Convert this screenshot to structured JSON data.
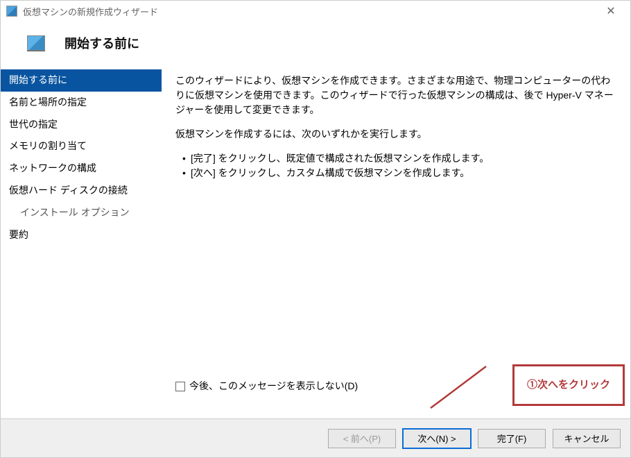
{
  "titlebar": {
    "title": "仮想マシンの新規作成ウィザード"
  },
  "header": {
    "title": "開始する前に"
  },
  "sidebar": {
    "items": [
      {
        "label": "開始する前に",
        "selected": true
      },
      {
        "label": "名前と場所の指定"
      },
      {
        "label": "世代の指定"
      },
      {
        "label": "メモリの割り当て"
      },
      {
        "label": "ネットワークの構成"
      },
      {
        "label": "仮想ハード ディスクの接続"
      },
      {
        "label": "インストール オプション",
        "indent": true
      },
      {
        "label": "要約"
      }
    ]
  },
  "content": {
    "intro": "このウィザードにより、仮想マシンを作成できます。さまざまな用途で、物理コンピューターの代わりに仮想マシンを使用できます。このウィザードで行った仮想マシンの構成は、後で Hyper-V マネージャーを使用して変更できます。",
    "instruction": "仮想マシンを作成するには、次のいずれかを実行します。",
    "bullets": [
      "[完了] をクリックし、既定値で構成された仮想マシンを作成します。",
      "[次へ] をクリックし、カスタム構成で仮想マシンを作成します。"
    ],
    "checkbox_label": "今後、このメッセージを表示しない(D)"
  },
  "annotation": {
    "text": "①次へをクリック"
  },
  "footer": {
    "prev": "< 前へ(P)",
    "next": "次へ(N) >",
    "finish": "完了(F)",
    "cancel": "キャンセル"
  }
}
